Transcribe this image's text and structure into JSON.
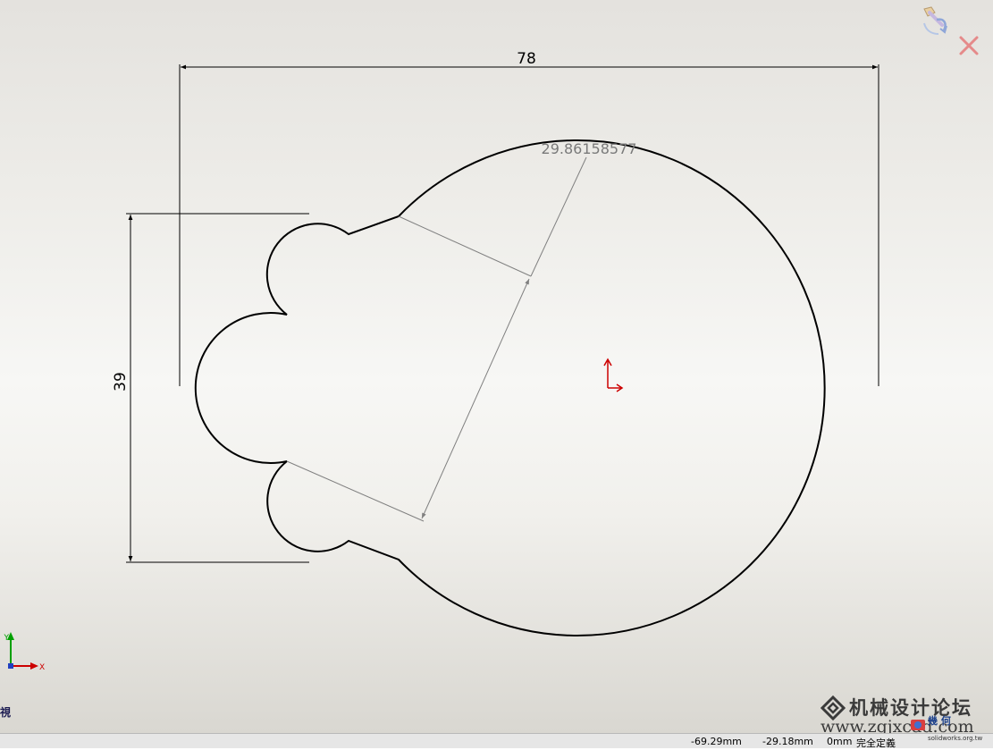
{
  "graphics": {
    "dimension_width": "78",
    "dimension_height": "39",
    "dimension_radius": "29.86158577"
  },
  "toolbar": {
    "confirm_icon": "confirm-corner-icon",
    "cancel_icon": "cancel-corner-icon"
  },
  "view": {
    "label": "前視"
  },
  "watermark": {
    "title": "机械设计论坛",
    "url": "www.zgjxcad.com",
    "logo_chars": "幾 何",
    "logo_site": "solidworks.org.tw"
  },
  "status": {
    "x_coord": "-69.29mm",
    "y_coord": "-29.18mm",
    "z_coord": "0mm",
    "state": "完全定義"
  },
  "colors": {
    "sketch_line": "#000000",
    "dimension_line": "#000000",
    "selected_dimension": "#808080",
    "origin": "#cc0000",
    "axis_y": "#00a000",
    "axis_x": "#cc0000"
  }
}
